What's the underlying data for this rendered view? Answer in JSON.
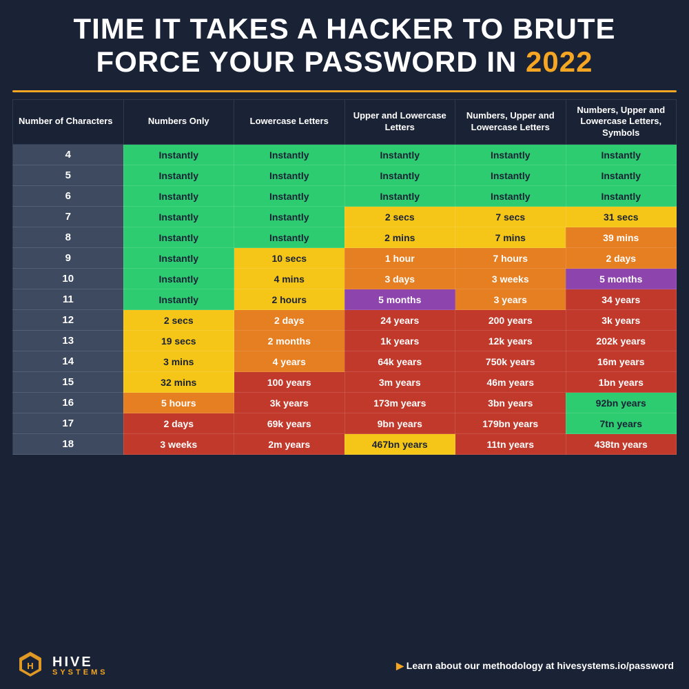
{
  "title": {
    "line1": "TIME IT TAKES A HACKER TO BRUTE",
    "line2": "FORCE YOUR PASSWORD IN ",
    "year": "2022"
  },
  "columns": [
    "Number of Characters",
    "Numbers Only",
    "Lowercase Letters",
    "Upper and Lowercase Letters",
    "Numbers, Upper and Lowercase Letters",
    "Numbers, Upper and Lowercase Letters, Symbols"
  ],
  "rows": [
    {
      "chars": "4",
      "c1": "Instantly",
      "c2": "Instantly",
      "c3": "Instantly",
      "c4": "Instantly",
      "c5": "Instantly"
    },
    {
      "chars": "5",
      "c1": "Instantly",
      "c2": "Instantly",
      "c3": "Instantly",
      "c4": "Instantly",
      "c5": "Instantly"
    },
    {
      "chars": "6",
      "c1": "Instantly",
      "c2": "Instantly",
      "c3": "Instantly",
      "c4": "Instantly",
      "c5": "Instantly"
    },
    {
      "chars": "7",
      "c1": "Instantly",
      "c2": "Instantly",
      "c3": "2 secs",
      "c4": "7 secs",
      "c5": "31 secs"
    },
    {
      "chars": "8",
      "c1": "Instantly",
      "c2": "Instantly",
      "c3": "2 mins",
      "c4": "7 mins",
      "c5": "39 mins"
    },
    {
      "chars": "9",
      "c1": "Instantly",
      "c2": "10 secs",
      "c3": "1 hour",
      "c4": "7 hours",
      "c5": "2 days"
    },
    {
      "chars": "10",
      "c1": "Instantly",
      "c2": "4 mins",
      "c3": "3 days",
      "c4": "3 weeks",
      "c5": "5 months"
    },
    {
      "chars": "11",
      "c1": "Instantly",
      "c2": "2 hours",
      "c3": "5 months",
      "c4": "3 years",
      "c5": "34 years"
    },
    {
      "chars": "12",
      "c1": "2 secs",
      "c2": "2 days",
      "c3": "24 years",
      "c4": "200 years",
      "c5": "3k years"
    },
    {
      "chars": "13",
      "c1": "19 secs",
      "c2": "2 months",
      "c3": "1k years",
      "c4": "12k years",
      "c5": "202k years"
    },
    {
      "chars": "14",
      "c1": "3 mins",
      "c2": "4 years",
      "c3": "64k years",
      "c4": "750k years",
      "c5": "16m years"
    },
    {
      "chars": "15",
      "c1": "32 mins",
      "c2": "100 years",
      "c3": "3m years",
      "c4": "46m years",
      "c5": "1bn years"
    },
    {
      "chars": "16",
      "c1": "5 hours",
      "c2": "3k years",
      "c3": "173m years",
      "c4": "3bn years",
      "c5": "92bn years"
    },
    {
      "chars": "17",
      "c1": "2 days",
      "c2": "69k years",
      "c3": "9bn years",
      "c4": "179bn years",
      "c5": "7tn years"
    },
    {
      "chars": "18",
      "c1": "3 weeks",
      "c2": "2m years",
      "c3": "467bn years",
      "c4": "11tn years",
      "c5": "438tn years"
    }
  ],
  "footer": {
    "logo_hive": "HIVE",
    "logo_systems": "SYSTEMS",
    "cta_prefix": "▶ Learn about our methodology at ",
    "cta_url": "hivesystems.io/password"
  }
}
